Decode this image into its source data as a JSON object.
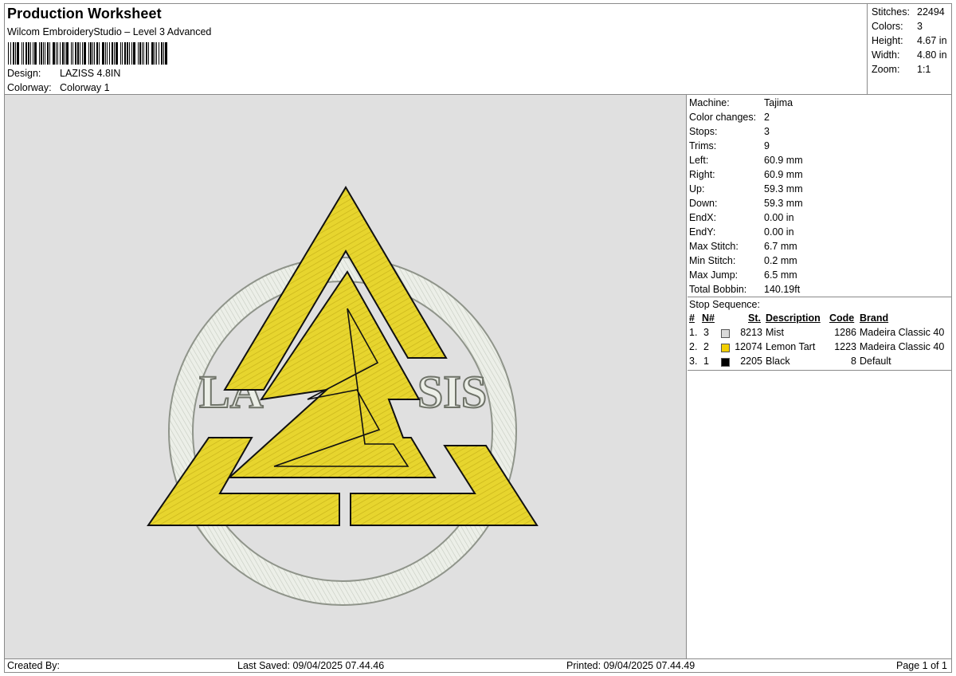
{
  "header": {
    "title": "Production Worksheet",
    "subtitle": "Wilcom EmbroideryStudio – Level 3 Advanced",
    "design_label": "Design:",
    "design_value": "LAZISS 4.8IN",
    "colorway_label": "Colorway:",
    "colorway_value": "Colorway 1"
  },
  "stats": [
    {
      "label": "Stitches:",
      "value": "22494"
    },
    {
      "label": "Colors:",
      "value": "3"
    },
    {
      "label": "Height:",
      "value": "4.67 in"
    },
    {
      "label": "Width:",
      "value": "4.80 in"
    },
    {
      "label": "Zoom:",
      "value": "1:1"
    }
  ],
  "machine": [
    {
      "label": "Machine:",
      "value": "Tajima"
    },
    {
      "label": "Color changes:",
      "value": "2"
    },
    {
      "label": "Stops:",
      "value": "3"
    },
    {
      "label": "Trims:",
      "value": "9"
    },
    {
      "label": "Left:",
      "value": "60.9 mm"
    },
    {
      "label": "Right:",
      "value": "60.9 mm"
    },
    {
      "label": "Up:",
      "value": "59.3 mm"
    },
    {
      "label": "Down:",
      "value": "59.3 mm"
    },
    {
      "label": "EndX:",
      "value": "0.00 in"
    },
    {
      "label": "EndY:",
      "value": "0.00 in"
    },
    {
      "label": "Max Stitch:",
      "value": "6.7 mm"
    },
    {
      "label": "Min Stitch:",
      "value": "0.2 mm"
    },
    {
      "label": "Max Jump:",
      "value": "6.5 mm"
    },
    {
      "label": "Total Bobbin:",
      "value": "140.19ft"
    }
  ],
  "stop_sequence": {
    "title": "Stop Sequence:",
    "headers": {
      "hash": "#",
      "n": "N#",
      "st": "St.",
      "description": "Description",
      "code": "Code",
      "brand": "Brand"
    },
    "rows": [
      {
        "idx": "1.",
        "n": "3",
        "color": "#d9d9d9",
        "st": "8213",
        "description": "Mist",
        "code": "1286",
        "brand": "Madeira Classic 40"
      },
      {
        "idx": "2.",
        "n": "2",
        "color": "#f2cf00",
        "st": "12074",
        "description": "Lemon Tart",
        "code": "1223",
        "brand": "Madeira Classic 40"
      },
      {
        "idx": "3.",
        "n": "1",
        "color": "#000000",
        "st": "2205",
        "description": "Black",
        "code": "8",
        "brand": "Default"
      }
    ]
  },
  "artwork": {
    "text_left": "LA",
    "text_right": "SIS",
    "colors": {
      "mist": "#e8ece4",
      "lemon": "#e7d52e",
      "black": "#111111",
      "canvas": "#e0e0e0"
    }
  },
  "footer": {
    "created_by": "Created By:",
    "last_saved": "Last Saved: 09/04/2025 07.44.46",
    "printed": "Printed: 09/04/2025 07.44.49",
    "page": "Page 1 of 1"
  }
}
